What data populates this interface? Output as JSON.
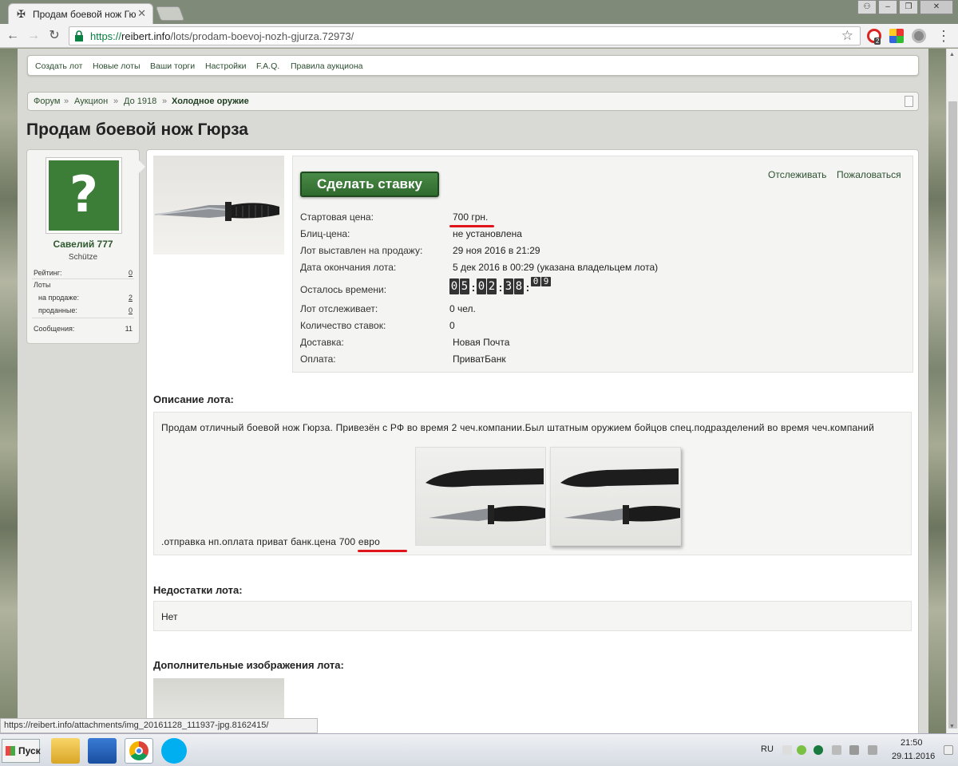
{
  "browser": {
    "tab_title": "Продам боевой нож Гю…",
    "url_scheme": "https://",
    "url_domain": "reibert.info",
    "url_path": "/lots/prodam-boevoj-nozh-gjurza.72973/",
    "status_url": "https://reibert.info/attachments/img_20161128_111937-jpg.8162415/",
    "extension_badge": "2"
  },
  "nav": {
    "items": [
      "Создать лот",
      "Новые лоты",
      "Ваши торги",
      "Настройки",
      "F.A.Q.",
      "Правила аукциона"
    ]
  },
  "breadcrumb": {
    "items": [
      "Форум",
      "Аукцион",
      "До 1918"
    ],
    "current": "Холодное оружие",
    "separator": "»"
  },
  "page_title": "Продам боевой нож Гюрза",
  "user": {
    "avatar_glyph": "?",
    "name": "Савелий 777",
    "title": "Schütze",
    "rating_label": "Рейтинг:",
    "rating": "0",
    "lots_label": "Лоты",
    "on_sale_label": "на продаже:",
    "on_sale": "2",
    "sold_label": "проданные:",
    "sold": "0",
    "messages_label": "Сообщения:",
    "messages": "11"
  },
  "lot": {
    "bid_button": "Сделать ставку",
    "watch_link": "Отслеживать",
    "report_link": "Пожаловаться",
    "fields": [
      {
        "label": "Стартовая цена:",
        "value": "700 грн."
      },
      {
        "label": "Блиц-цена:",
        "value": "не установлена"
      },
      {
        "label": "Лот выставлен на продажу:",
        "value": "29 ноя 2016 в 21:29"
      },
      {
        "label": "Дата окончания лота:",
        "value": "5 дек 2016 в 00:29 (указана владельцем лота)"
      },
      {
        "label": "Осталось времени:",
        "value": ""
      },
      {
        "label": "Лот отслеживает:",
        "value": "0 чел."
      },
      {
        "label": "Количество ставок:",
        "value": "0"
      },
      {
        "label": "Доставка:",
        "value": "Новая Почта"
      },
      {
        "label": "Оплата:",
        "value": "ПриватБанк"
      }
    ],
    "timer": {
      "d": [
        "0",
        "5"
      ],
      "h": [
        "0",
        "2"
      ],
      "m": [
        "3",
        "8"
      ],
      "s": [
        "0",
        "9"
      ]
    }
  },
  "description": {
    "heading": "Описание лота:",
    "text": "Продам отличный боевой нож Гюрза. Привезён с РФ во время 2 чеч.компании.Был штатным оружием бойцов спец.подразделений во время чеч.компаний",
    "text2_prefix": ".отправка нп.оплата приват банк.цена ",
    "text2_price": "700 евро"
  },
  "defects": {
    "heading": "Недостатки лота:",
    "text": "Нет"
  },
  "extra_images": {
    "heading": "Дополнительные изображения лота:"
  },
  "taskbar": {
    "start": "Пуск",
    "lang": "RU",
    "time": "21:50",
    "date": "29.11.2016"
  },
  "colors": {
    "accent_green": "#2f6a2d",
    "highlight_red": "#e0151b",
    "link_green": "#2c5130"
  }
}
